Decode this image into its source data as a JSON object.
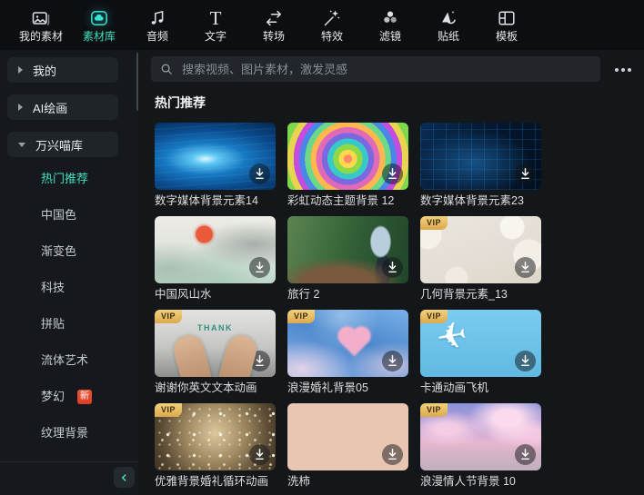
{
  "toolbar": {
    "items": [
      {
        "label": "我的素材",
        "icon": "my-media",
        "selected": false
      },
      {
        "label": "素材库",
        "icon": "library",
        "selected": true
      },
      {
        "label": "音频",
        "icon": "audio",
        "selected": false
      },
      {
        "label": "文字",
        "icon": "text",
        "selected": false
      },
      {
        "label": "转场",
        "icon": "transition",
        "selected": false
      },
      {
        "label": "特效",
        "icon": "effects",
        "selected": false
      },
      {
        "label": "滤镜",
        "icon": "filter",
        "selected": false
      },
      {
        "label": "贴纸",
        "icon": "sticker",
        "selected": false
      },
      {
        "label": "模板",
        "icon": "template",
        "selected": false
      }
    ]
  },
  "sidebar": {
    "groups": [
      {
        "label": "我的",
        "expanded": false
      },
      {
        "label": "AI绘画",
        "expanded": false
      },
      {
        "label": "万兴喵库",
        "expanded": true
      }
    ],
    "subitems": [
      {
        "label": "热门推荐",
        "selected": true
      },
      {
        "label": "中国色",
        "selected": false
      },
      {
        "label": "渐变色",
        "selected": false
      },
      {
        "label": "科技",
        "selected": false
      },
      {
        "label": "拼贴",
        "selected": false
      },
      {
        "label": "流体艺术",
        "selected": false
      },
      {
        "label": "梦幻",
        "selected": false,
        "badge": "新"
      },
      {
        "label": "纹理背景",
        "selected": false
      }
    ]
  },
  "search": {
    "placeholder": "搜索视频、图片素材，激发灵感"
  },
  "main": {
    "section_title": "热门推荐",
    "vip_label": "VIP",
    "cards": [
      {
        "title": "数字媒体背景元素14",
        "vip": false
      },
      {
        "title": "彩虹动态主题背景 12",
        "vip": false
      },
      {
        "title": "数字媒体背景元素23",
        "vip": false
      },
      {
        "title": "中国风山水",
        "vip": false
      },
      {
        "title": "旅行 2",
        "vip": false
      },
      {
        "title": "几何背景元素_13",
        "vip": true
      },
      {
        "title": "谢谢你英文文本动画",
        "vip": true,
        "overlay_text": "THANK"
      },
      {
        "title": "浪漫婚礼背景05",
        "vip": true
      },
      {
        "title": "卡通动画飞机",
        "vip": true
      },
      {
        "title": "优雅背景婚礼循环动画",
        "vip": true
      },
      {
        "title": "洗柿",
        "vip": false
      },
      {
        "title": "浪漫情人节背景 10",
        "vip": true
      }
    ]
  },
  "colors": {
    "accent_teal": "#3fe0bd",
    "icon_cyan": "#3be3d6",
    "vip_gold": "#dca94e",
    "new_badge_red": "#e8492f"
  }
}
